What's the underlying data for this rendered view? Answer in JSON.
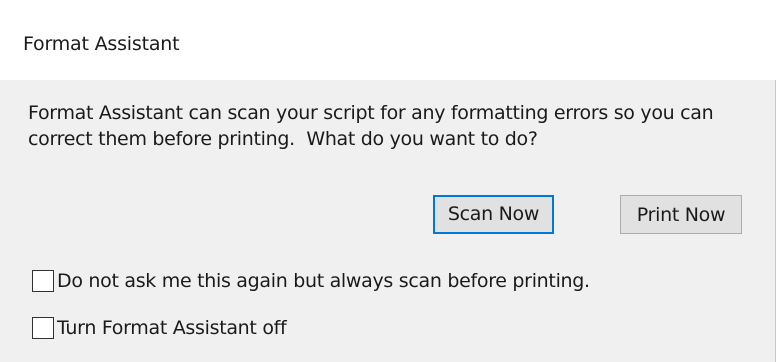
{
  "window": {
    "title": "Format Assistant"
  },
  "message": {
    "line1": "Format Assistant can scan your script for any formatting errors so you can",
    "line2": "correct them before printing.  What do you want to do?"
  },
  "buttons": {
    "scan_now": "Scan Now",
    "print_now": "Print Now"
  },
  "options": [
    {
      "label": "Do not ask me this again but always scan before printing.",
      "checked": false
    },
    {
      "label": "Turn Format Assistant off",
      "checked": false
    }
  ],
  "colors": {
    "default_button_border": "#0078d7",
    "button_face": "#e1e1e1",
    "dialog_background": "#f0f0f0"
  }
}
